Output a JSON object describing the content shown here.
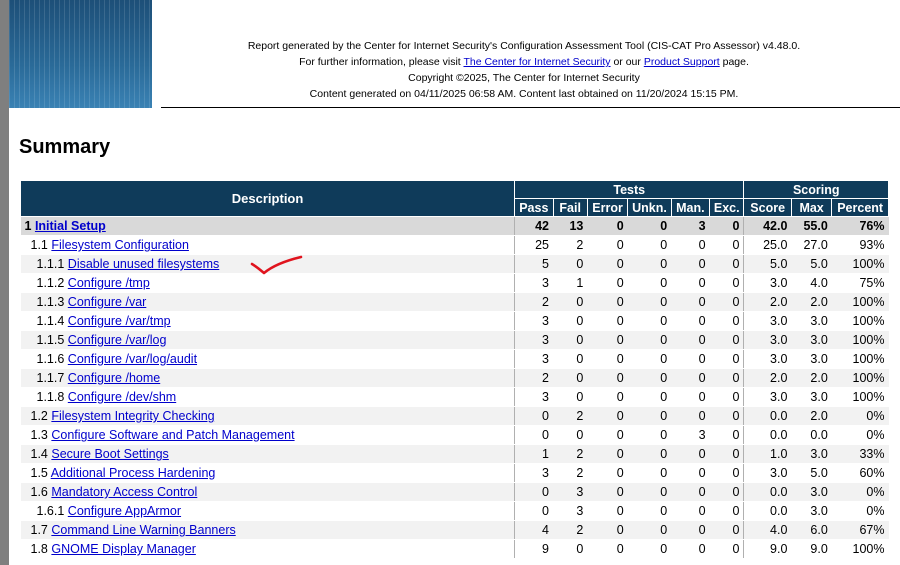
{
  "banner": {
    "line1": "Report generated by the Center for Internet Security's Configuration Assessment Tool (CIS-CAT Pro Assessor) v4.48.0.",
    "line2_pre": "For further information, please visit ",
    "line2_link1": "The Center for Internet Security",
    "line2_mid": " or our ",
    "line2_link2": "Product Support",
    "line2_post": " page.",
    "line3": "Copyright ©2025, The Center for Internet Security",
    "line4": "Content generated on 04/11/2025 06:58 AM. Content last obtained on 11/20/2024 15:15 PM."
  },
  "summary": {
    "title": "Summary",
    "headers": {
      "description": "Description",
      "tests": "Tests",
      "scoring": "Scoring",
      "pass": "Pass",
      "fail": "Fail",
      "error": "Error",
      "unkn": "Unkn.",
      "man": "Man.",
      "exc": "Exc.",
      "score": "Score",
      "max": "Max",
      "percent": "Percent"
    },
    "rows": [
      {
        "num": "1",
        "label": "Initial Setup",
        "pass": "42",
        "fail": "13",
        "error": "0",
        "unkn": "0",
        "man": "3",
        "exc": "0",
        "score": "42.0",
        "max": "55.0",
        "percent": "76%",
        "level": 0
      },
      {
        "num": "1.1",
        "label": "Filesystem Configuration",
        "pass": "25",
        "fail": "2",
        "error": "0",
        "unkn": "0",
        "man": "0",
        "exc": "0",
        "score": "25.0",
        "max": "27.0",
        "percent": "93%",
        "level": 1
      },
      {
        "num": "1.1.1",
        "label": "Disable unused filesystems",
        "pass": "5",
        "fail": "0",
        "error": "0",
        "unkn": "0",
        "man": "0",
        "exc": "0",
        "score": "5.0",
        "max": "5.0",
        "percent": "100%",
        "level": 2
      },
      {
        "num": "1.1.2",
        "label": "Configure /tmp",
        "pass": "3",
        "fail": "1",
        "error": "0",
        "unkn": "0",
        "man": "0",
        "exc": "0",
        "score": "3.0",
        "max": "4.0",
        "percent": "75%",
        "level": 2
      },
      {
        "num": "1.1.3",
        "label": "Configure /var",
        "pass": "2",
        "fail": "0",
        "error": "0",
        "unkn": "0",
        "man": "0",
        "exc": "0",
        "score": "2.0",
        "max": "2.0",
        "percent": "100%",
        "level": 2
      },
      {
        "num": "1.1.4",
        "label": "Configure /var/tmp",
        "pass": "3",
        "fail": "0",
        "error": "0",
        "unkn": "0",
        "man": "0",
        "exc": "0",
        "score": "3.0",
        "max": "3.0",
        "percent": "100%",
        "level": 2
      },
      {
        "num": "1.1.5",
        "label": "Configure /var/log",
        "pass": "3",
        "fail": "0",
        "error": "0",
        "unkn": "0",
        "man": "0",
        "exc": "0",
        "score": "3.0",
        "max": "3.0",
        "percent": "100%",
        "level": 2
      },
      {
        "num": "1.1.6",
        "label": "Configure /var/log/audit",
        "pass": "3",
        "fail": "0",
        "error": "0",
        "unkn": "0",
        "man": "0",
        "exc": "0",
        "score": "3.0",
        "max": "3.0",
        "percent": "100%",
        "level": 2
      },
      {
        "num": "1.1.7",
        "label": "Configure /home",
        "pass": "2",
        "fail": "0",
        "error": "0",
        "unkn": "0",
        "man": "0",
        "exc": "0",
        "score": "2.0",
        "max": "2.0",
        "percent": "100%",
        "level": 2
      },
      {
        "num": "1.1.8",
        "label": "Configure /dev/shm",
        "pass": "3",
        "fail": "0",
        "error": "0",
        "unkn": "0",
        "man": "0",
        "exc": "0",
        "score": "3.0",
        "max": "3.0",
        "percent": "100%",
        "level": 2
      },
      {
        "num": "1.2",
        "label": "Filesystem Integrity Checking",
        "pass": "0",
        "fail": "2",
        "error": "0",
        "unkn": "0",
        "man": "0",
        "exc": "0",
        "score": "0.0",
        "max": "2.0",
        "percent": "0%",
        "level": 1
      },
      {
        "num": "1.3",
        "label": "Configure Software and Patch Management",
        "pass": "0",
        "fail": "0",
        "error": "0",
        "unkn": "0",
        "man": "3",
        "exc": "0",
        "score": "0.0",
        "max": "0.0",
        "percent": "0%",
        "level": 1
      },
      {
        "num": "1.4",
        "label": "Secure Boot Settings",
        "pass": "1",
        "fail": "2",
        "error": "0",
        "unkn": "0",
        "man": "0",
        "exc": "0",
        "score": "1.0",
        "max": "3.0",
        "percent": "33%",
        "level": 1
      },
      {
        "num": "1.5",
        "label": "Additional Process Hardening",
        "pass": "3",
        "fail": "2",
        "error": "0",
        "unkn": "0",
        "man": "0",
        "exc": "0",
        "score": "3.0",
        "max": "5.0",
        "percent": "60%",
        "level": 1
      },
      {
        "num": "1.6",
        "label": "Mandatory Access Control",
        "pass": "0",
        "fail": "3",
        "error": "0",
        "unkn": "0",
        "man": "0",
        "exc": "0",
        "score": "0.0",
        "max": "3.0",
        "percent": "0%",
        "level": 1
      },
      {
        "num": "1.6.1",
        "label": "Configure AppArmor",
        "pass": "0",
        "fail": "3",
        "error": "0",
        "unkn": "0",
        "man": "0",
        "exc": "0",
        "score": "0.0",
        "max": "3.0",
        "percent": "0%",
        "level": 2
      },
      {
        "num": "1.7",
        "label": "Command Line Warning Banners",
        "pass": "4",
        "fail": "2",
        "error": "0",
        "unkn": "0",
        "man": "0",
        "exc": "0",
        "score": "4.0",
        "max": "6.0",
        "percent": "67%",
        "level": 1
      },
      {
        "num": "1.8",
        "label": "GNOME Display Manager",
        "pass": "9",
        "fail": "0",
        "error": "0",
        "unkn": "0",
        "man": "0",
        "exc": "0",
        "score": "9.0",
        "max": "9.0",
        "percent": "100%",
        "level": 1
      }
    ]
  },
  "colors": {
    "header_bg": "#0f3b5a",
    "pass": "#2ecc40",
    "fail": "#e6262f",
    "error": "#e87722",
    "unkn": "#1e7fc8",
    "link": "#0000cc",
    "annotation": "#e0141e"
  },
  "annotation": {
    "icon": "red-checkmark-icon"
  }
}
